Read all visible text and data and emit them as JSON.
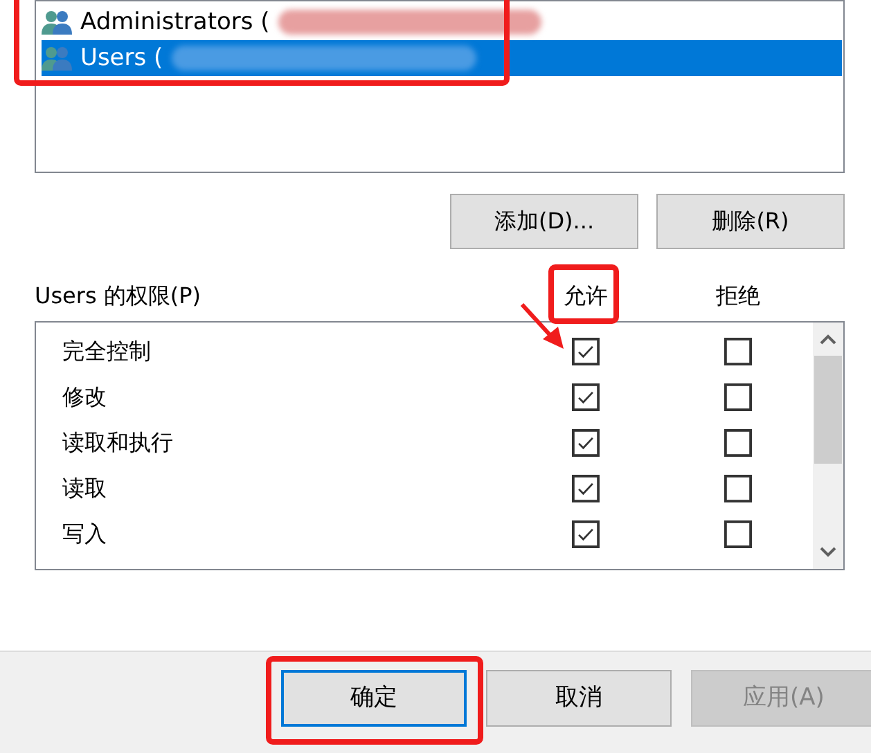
{
  "principals": [
    {
      "name": "Administrators (",
      "selected": false,
      "redacted": true
    },
    {
      "name": "Users (",
      "selected": true,
      "redacted": true
    }
  ],
  "principal_buttons": [
    "添加(D)...",
    "删除(R)"
  ],
  "permissions": {
    "label": "Users 的权限(P)",
    "columns": [
      "允许",
      "拒绝"
    ],
    "rows": [
      {
        "name": "完全控制",
        "allow": true,
        "deny": false
      },
      {
        "name": "修改",
        "allow": true,
        "deny": false
      },
      {
        "name": "读取和执行",
        "allow": true,
        "deny": false
      },
      {
        "name": "读取",
        "allow": true,
        "deny": false
      },
      {
        "name": "写入",
        "allow": true,
        "deny": false
      }
    ]
  },
  "dialog_buttons": [
    {
      "label": "确定",
      "default": true,
      "disabled": false
    },
    {
      "label": "取消",
      "default": false,
      "disabled": false
    },
    {
      "label": "应用(A)",
      "default": false,
      "disabled": true
    }
  ],
  "annotations": [
    {
      "kind": "frame"
    },
    {
      "kind": "frame"
    },
    {
      "kind": "arrow"
    },
    {
      "kind": "frame"
    }
  ]
}
